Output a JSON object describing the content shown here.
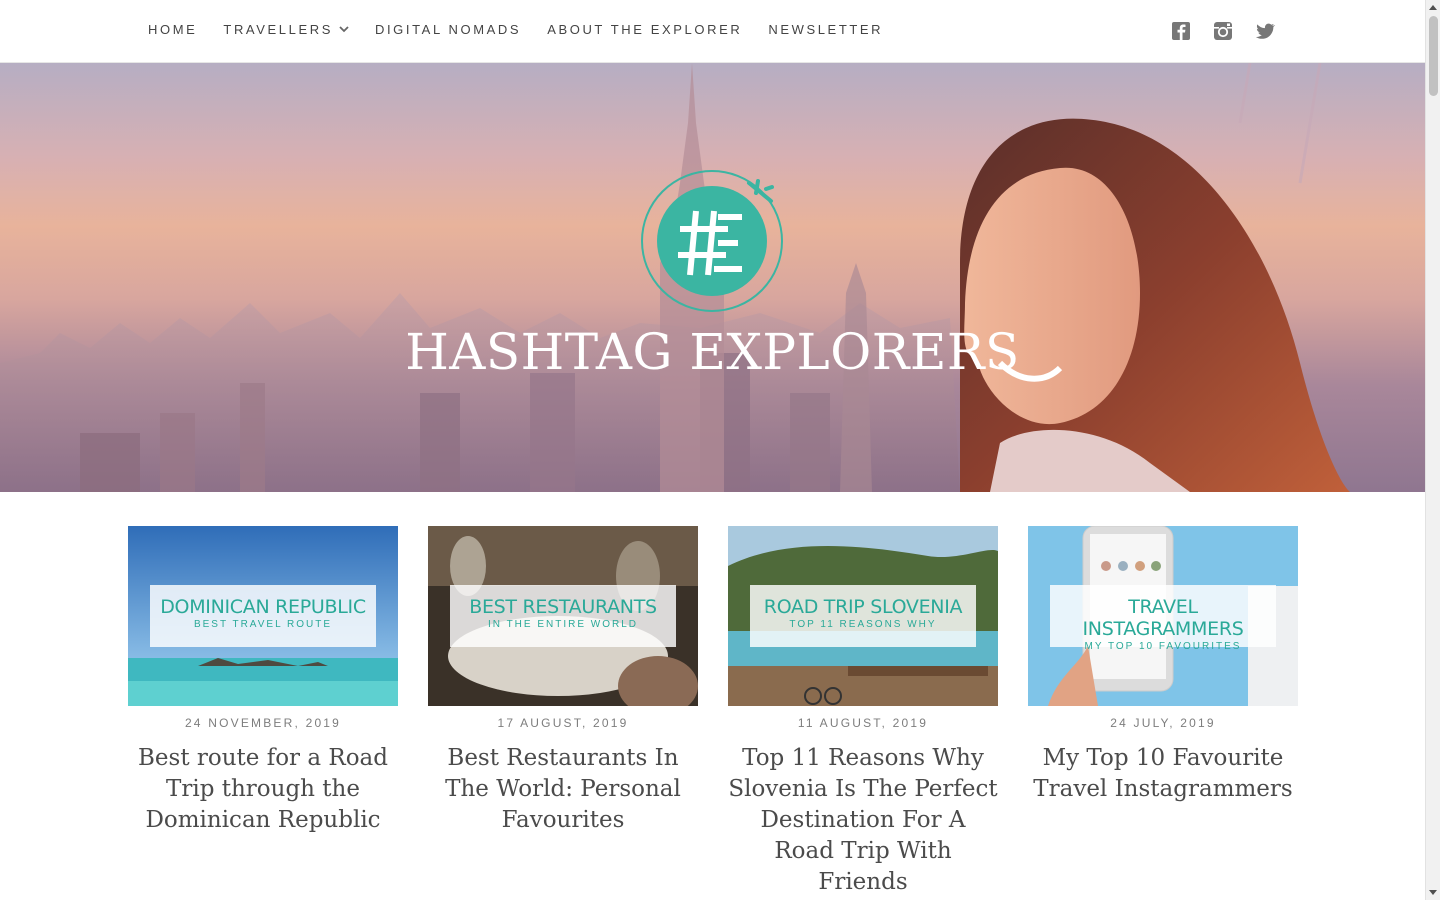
{
  "nav": {
    "items": [
      {
        "label": "HOME"
      },
      {
        "label": "TRAVELLERS",
        "has_dropdown": true
      },
      {
        "label": "DIGITAL NOMADS"
      },
      {
        "label": "ABOUT THE EXPLORER"
      },
      {
        "label": "NEWSLETTER"
      }
    ],
    "social": [
      "facebook-icon",
      "instagram-icon",
      "twitter-icon"
    ]
  },
  "hero": {
    "title": "HASHTAG EXPLORERS",
    "logo_glyph": "#E",
    "logo_color": "#3bb5a2"
  },
  "posts": [
    {
      "badge_title": "DOMINICAN REPUBLIC",
      "badge_sub": "BEST TRAVEL ROUTE",
      "date": "24 NOVEMBER, 2019",
      "title": "Best route for a Road Trip through the Dominican Republic"
    },
    {
      "badge_title": "BEST RESTAURANTS",
      "badge_sub": "IN THE ENTIRE WORLD",
      "date": "17 AUGUST, 2019",
      "title": "Best Restaurants In The World: Personal Favourites"
    },
    {
      "badge_title": "ROAD TRIP SLOVENIA",
      "badge_sub": "TOP 11 REASONS WHY",
      "date": "11 AUGUST, 2019",
      "title": "Top 11 Reasons Why Slovenia Is The Perfect Destination For A Road Trip With Friends"
    },
    {
      "badge_title": "TRAVEL INSTAGRAMMERS",
      "badge_sub": "MY TOP 10 FAVOURITES",
      "date": "24 JULY, 2019",
      "title": "My Top 10 Favourite Travel Instagrammers"
    }
  ],
  "colors": {
    "accent": "#2aa998",
    "text": "#4b4b4b"
  }
}
